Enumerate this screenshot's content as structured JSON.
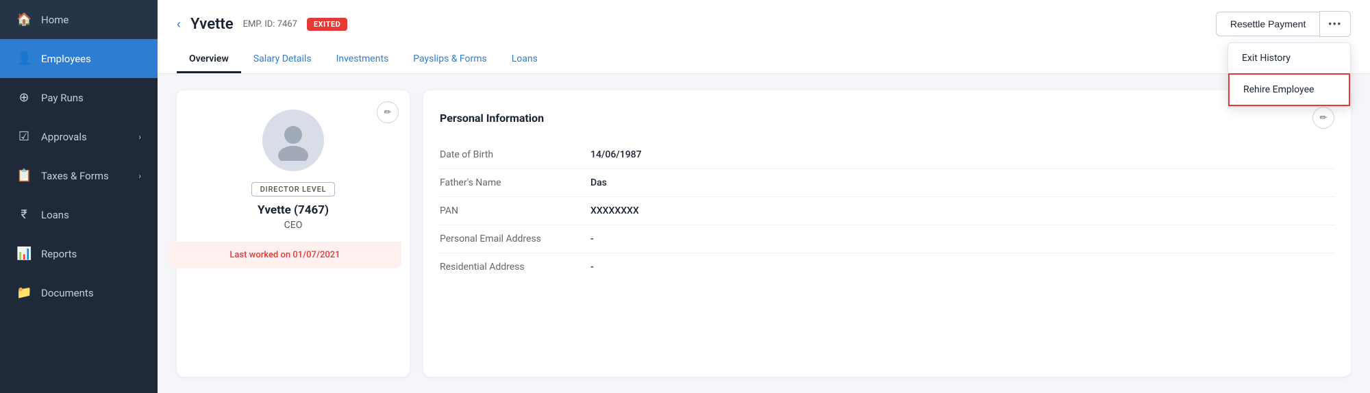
{
  "sidebar": {
    "items": [
      {
        "id": "home",
        "label": "Home",
        "icon": "🏠",
        "active": false
      },
      {
        "id": "employees",
        "label": "Employees",
        "icon": "👤",
        "active": true
      },
      {
        "id": "pay-runs",
        "label": "Pay Runs",
        "icon": "⊕",
        "active": false
      },
      {
        "id": "approvals",
        "label": "Approvals",
        "icon": "✓",
        "active": false,
        "hasArrow": true
      },
      {
        "id": "taxes-forms",
        "label": "Taxes & Forms",
        "icon": "🧾",
        "active": false,
        "hasArrow": true
      },
      {
        "id": "loans",
        "label": "Loans",
        "icon": "₹",
        "active": false
      },
      {
        "id": "reports",
        "label": "Reports",
        "icon": "📊",
        "active": false
      },
      {
        "id": "documents",
        "label": "Documents",
        "icon": "📁",
        "active": false
      }
    ]
  },
  "header": {
    "back_label": "‹",
    "emp_name": "Yvette",
    "emp_id_label": "EMP. ID: 7467",
    "exited_badge": "EXITED",
    "resettle_btn": "Resettle Payment",
    "more_btn": "•••"
  },
  "tabs": [
    {
      "id": "overview",
      "label": "Overview",
      "active": true
    },
    {
      "id": "salary-details",
      "label": "Salary Details",
      "active": false
    },
    {
      "id": "investments",
      "label": "Investments",
      "active": false
    },
    {
      "id": "payslips-forms",
      "label": "Payslips & Forms",
      "active": false
    },
    {
      "id": "loans",
      "label": "Loans",
      "active": false
    }
  ],
  "dropdown": {
    "items": [
      {
        "id": "exit-history",
        "label": "Exit History",
        "highlighted": false
      },
      {
        "id": "rehire-employee",
        "label": "Rehire Employee",
        "highlighted": true
      }
    ]
  },
  "profile": {
    "level_badge": "DIRECTOR LEVEL",
    "name": "Yvette (7467)",
    "title": "CEO",
    "last_worked": "Last worked on 01/07/2021",
    "edit_icon": "✏"
  },
  "personal_info": {
    "title": "Personal Information",
    "edit_icon": "✏",
    "fields": [
      {
        "label": "Date of Birth",
        "value": "14/06/1987"
      },
      {
        "label": "Father's Name",
        "value": "Das"
      },
      {
        "label": "PAN",
        "value": "XXXXXXXX"
      },
      {
        "label": "Personal Email Address",
        "value": "-"
      },
      {
        "label": "Residential Address",
        "value": "-"
      }
    ]
  }
}
